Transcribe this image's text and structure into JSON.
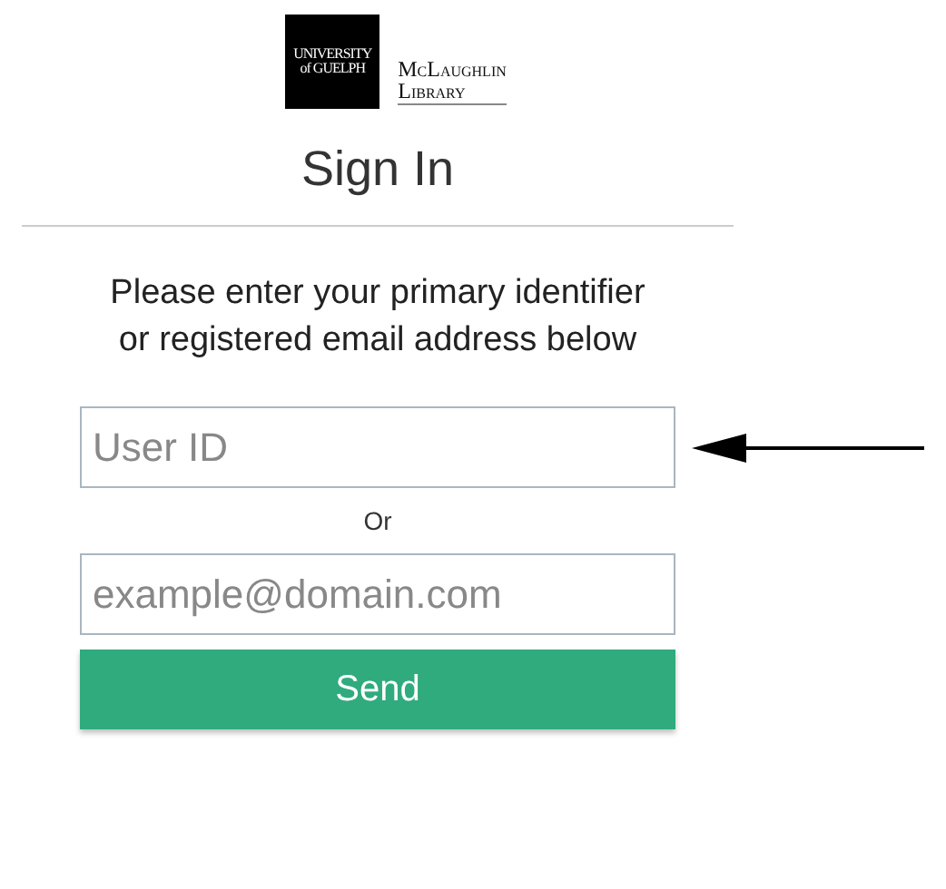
{
  "logo": {
    "university": [
      "UNIVERSITY",
      "of GUELPH"
    ],
    "library": [
      "McLaughlin",
      "Library"
    ]
  },
  "title": "Sign In",
  "instructions": "Please enter your primary identifier or registered email address below",
  "user_field": {
    "placeholder": "User ID"
  },
  "separator": "Or",
  "email_field": {
    "placeholder": "example@domain.com"
  },
  "button": "Send"
}
